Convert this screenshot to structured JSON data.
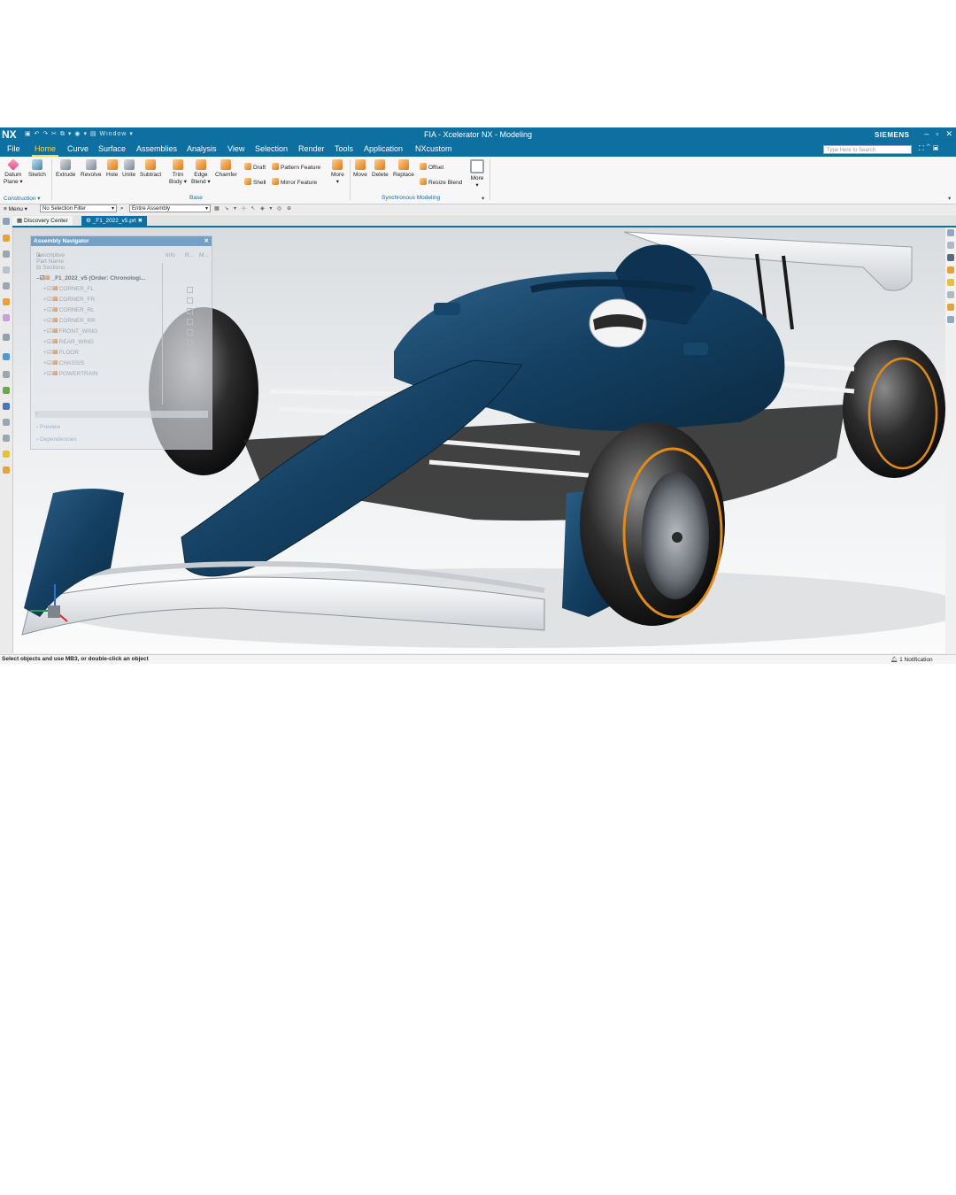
{
  "title_bar": {
    "app_logo": "NX",
    "quick_access": "Window",
    "title": "FIA  -  Xcelerator NX - Modeling",
    "brand": "SIEMENS"
  },
  "menu": {
    "tabs": [
      "File",
      "Home",
      "Curve",
      "Surface",
      "Assemblies",
      "Analysis",
      "View",
      "Selection",
      "Render",
      "Tools",
      "Application",
      "NXcustom"
    ],
    "active": "Home",
    "search_placeholder": "Type Here to Search"
  },
  "ribbon": {
    "datum": "Datum",
    "datum2": "Plane",
    "sketch": "Sketch",
    "extrude": "Extrude",
    "revolve": "Revolve",
    "hole": "Hole",
    "unite": "Unite",
    "subtract": "Subtract",
    "trim": "Trim",
    "trim2": "Body",
    "edge": "Edge",
    "edge2": "Blend",
    "chamfer": "Chamfer",
    "draft": "Draft",
    "pattern_feature": "Pattern Feature",
    "shell": "Shell",
    "mirror_feature": "Mirror Feature",
    "more1": "More",
    "move": "Move",
    "delete": "Delete",
    "replace": "Replace",
    "offset": "Offset",
    "resize_blend": "Resize Blend",
    "more2": "More",
    "group_construction": "Construction",
    "group_base": "Base",
    "group_sync": "Synchronous Modeling"
  },
  "selection_bar": {
    "menu": "Menu",
    "filter": "No Selection Filter",
    "scope": "Entire Assembly"
  },
  "doc_tabs": {
    "discovery": "Discovery Center",
    "part": "_F1_2022_v5.prt"
  },
  "assembly_navigator": {
    "title": "Assembly Navigator",
    "col_name": "Descriptive Part Name",
    "col_info": "Info",
    "col_r": "R...",
    "col_m": "M...",
    "sections": "Sections",
    "root": "_F1_2022_v5 (Order: Chronologi...",
    "children": [
      "CORNER_FL",
      "CORNER_FR",
      "CORNER_RL",
      "CORNER_RR",
      "FRONT_WING",
      "REAR_WING",
      "FLOOR",
      "CHASSIS",
      "POWERTRAIN"
    ],
    "preview": "Preview",
    "dependencies": "Dependencies"
  },
  "status": {
    "message": "Select objects and use MB3, or double-click an object",
    "notification": "1 Notification"
  },
  "colors": {
    "nx_blue": "#0e6fa1",
    "car_body": "#123c5c",
    "tyre_stripe": "#e08a1c"
  }
}
